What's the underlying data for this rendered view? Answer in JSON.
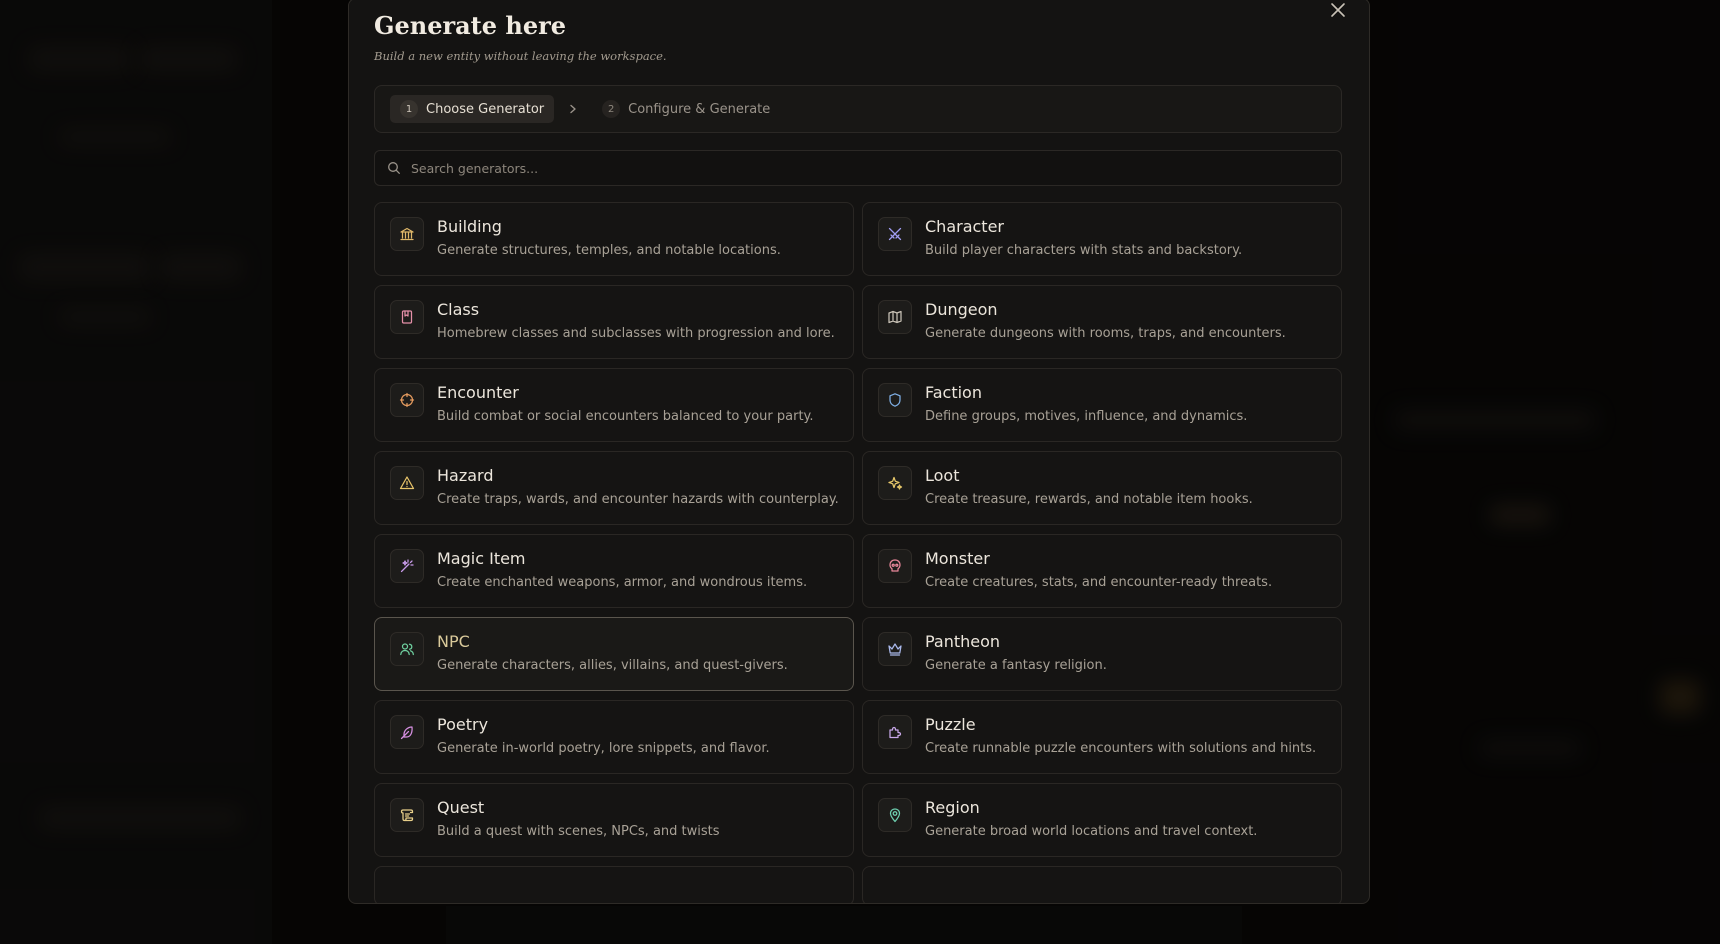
{
  "modal": {
    "title": "Generate here",
    "subtitle": "Build a new entity without leaving the workspace."
  },
  "steps": [
    {
      "number": "1",
      "label": "Choose Generator",
      "active": true
    },
    {
      "number": "2",
      "label": "Configure & Generate",
      "active": false
    }
  ],
  "search": {
    "placeholder": "Search generators..."
  },
  "generators": [
    {
      "title": "Building",
      "desc": "Generate structures, temples, and notable locations.",
      "icon": "building-icon",
      "color": "#e0b86a"
    },
    {
      "title": "Character",
      "desc": "Build player characters with stats and backstory.",
      "icon": "swords-icon",
      "color": "#9f9cf0"
    },
    {
      "title": "Class",
      "desc": "Homebrew classes and subclasses with progression and lore.",
      "icon": "book-icon",
      "color": "#e58fa8"
    },
    {
      "title": "Dungeon",
      "desc": "Generate dungeons with rooms, traps, and encounters.",
      "icon": "map-icon",
      "color": "#c9c2b6"
    },
    {
      "title": "Encounter",
      "desc": "Build combat or social encounters balanced to your party.",
      "icon": "crosshair-icon",
      "color": "#e49a5e"
    },
    {
      "title": "Faction",
      "desc": "Define groups, motives, influence, and dynamics.",
      "icon": "shield-icon",
      "color": "#7fb0e6"
    },
    {
      "title": "Hazard",
      "desc": "Create traps, wards, and encounter hazards with counterplay.",
      "icon": "warning-icon",
      "color": "#e8c46a"
    },
    {
      "title": "Loot",
      "desc": "Create treasure, rewards, and notable item hooks.",
      "icon": "sparkles-icon",
      "color": "#e8c86a"
    },
    {
      "title": "Magic Item",
      "desc": "Create enchanted weapons, armor, and wondrous items.",
      "icon": "wand-icon",
      "color": "#c79ae8"
    },
    {
      "title": "Monster",
      "desc": "Create creatures, stats, and encounter-ready threats.",
      "icon": "skull-icon",
      "color": "#e8879a"
    },
    {
      "title": "NPC",
      "desc": "Generate characters, allies, villains, and quest-givers.",
      "icon": "users-icon",
      "color": "#6fd0a0",
      "selected": true
    },
    {
      "title": "Pantheon",
      "desc": "Generate a fantasy religion.",
      "icon": "crown-icon",
      "color": "#a9b8ea"
    },
    {
      "title": "Poetry",
      "desc": "Generate in-world poetry, lore snippets, and flavor.",
      "icon": "feather-icon",
      "color": "#d58fe0"
    },
    {
      "title": "Puzzle",
      "desc": "Create runnable puzzle encounters with solutions and hints.",
      "icon": "puzzle-icon",
      "color": "#c9a8ea"
    },
    {
      "title": "Quest",
      "desc": "Build a quest with scenes, NPCs, and twists",
      "icon": "scroll-icon",
      "color": "#e8d08a"
    },
    {
      "title": "Region",
      "desc": "Generate broad world locations and travel context.",
      "icon": "map-pin-icon",
      "color": "#6fd0b0"
    }
  ]
}
